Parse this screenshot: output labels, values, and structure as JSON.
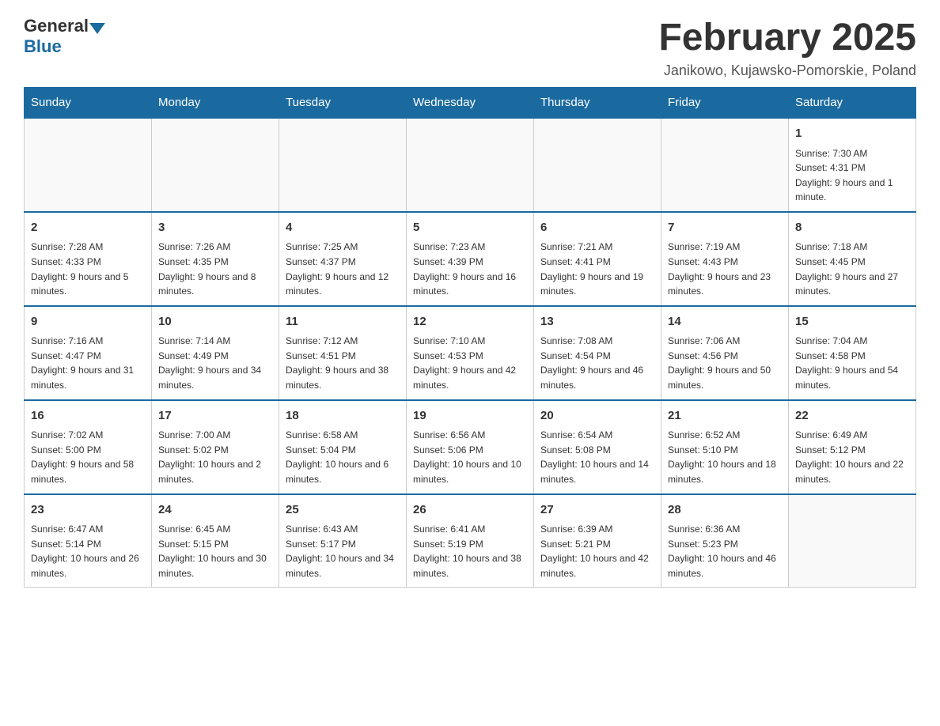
{
  "logo": {
    "text_general": "General",
    "text_blue": "Blue"
  },
  "header": {
    "month_title": "February 2025",
    "location": "Janikowo, Kujawsko-Pomorskie, Poland"
  },
  "days_of_week": [
    "Sunday",
    "Monday",
    "Tuesday",
    "Wednesday",
    "Thursday",
    "Friday",
    "Saturday"
  ],
  "weeks": [
    [
      {
        "day": "",
        "info": ""
      },
      {
        "day": "",
        "info": ""
      },
      {
        "day": "",
        "info": ""
      },
      {
        "day": "",
        "info": ""
      },
      {
        "day": "",
        "info": ""
      },
      {
        "day": "",
        "info": ""
      },
      {
        "day": "1",
        "info": "Sunrise: 7:30 AM\nSunset: 4:31 PM\nDaylight: 9 hours and 1 minute."
      }
    ],
    [
      {
        "day": "2",
        "info": "Sunrise: 7:28 AM\nSunset: 4:33 PM\nDaylight: 9 hours and 5 minutes."
      },
      {
        "day": "3",
        "info": "Sunrise: 7:26 AM\nSunset: 4:35 PM\nDaylight: 9 hours and 8 minutes."
      },
      {
        "day": "4",
        "info": "Sunrise: 7:25 AM\nSunset: 4:37 PM\nDaylight: 9 hours and 12 minutes."
      },
      {
        "day": "5",
        "info": "Sunrise: 7:23 AM\nSunset: 4:39 PM\nDaylight: 9 hours and 16 minutes."
      },
      {
        "day": "6",
        "info": "Sunrise: 7:21 AM\nSunset: 4:41 PM\nDaylight: 9 hours and 19 minutes."
      },
      {
        "day": "7",
        "info": "Sunrise: 7:19 AM\nSunset: 4:43 PM\nDaylight: 9 hours and 23 minutes."
      },
      {
        "day": "8",
        "info": "Sunrise: 7:18 AM\nSunset: 4:45 PM\nDaylight: 9 hours and 27 minutes."
      }
    ],
    [
      {
        "day": "9",
        "info": "Sunrise: 7:16 AM\nSunset: 4:47 PM\nDaylight: 9 hours and 31 minutes."
      },
      {
        "day": "10",
        "info": "Sunrise: 7:14 AM\nSunset: 4:49 PM\nDaylight: 9 hours and 34 minutes."
      },
      {
        "day": "11",
        "info": "Sunrise: 7:12 AM\nSunset: 4:51 PM\nDaylight: 9 hours and 38 minutes."
      },
      {
        "day": "12",
        "info": "Sunrise: 7:10 AM\nSunset: 4:53 PM\nDaylight: 9 hours and 42 minutes."
      },
      {
        "day": "13",
        "info": "Sunrise: 7:08 AM\nSunset: 4:54 PM\nDaylight: 9 hours and 46 minutes."
      },
      {
        "day": "14",
        "info": "Sunrise: 7:06 AM\nSunset: 4:56 PM\nDaylight: 9 hours and 50 minutes."
      },
      {
        "day": "15",
        "info": "Sunrise: 7:04 AM\nSunset: 4:58 PM\nDaylight: 9 hours and 54 minutes."
      }
    ],
    [
      {
        "day": "16",
        "info": "Sunrise: 7:02 AM\nSunset: 5:00 PM\nDaylight: 9 hours and 58 minutes."
      },
      {
        "day": "17",
        "info": "Sunrise: 7:00 AM\nSunset: 5:02 PM\nDaylight: 10 hours and 2 minutes."
      },
      {
        "day": "18",
        "info": "Sunrise: 6:58 AM\nSunset: 5:04 PM\nDaylight: 10 hours and 6 minutes."
      },
      {
        "day": "19",
        "info": "Sunrise: 6:56 AM\nSunset: 5:06 PM\nDaylight: 10 hours and 10 minutes."
      },
      {
        "day": "20",
        "info": "Sunrise: 6:54 AM\nSunset: 5:08 PM\nDaylight: 10 hours and 14 minutes."
      },
      {
        "day": "21",
        "info": "Sunrise: 6:52 AM\nSunset: 5:10 PM\nDaylight: 10 hours and 18 minutes."
      },
      {
        "day": "22",
        "info": "Sunrise: 6:49 AM\nSunset: 5:12 PM\nDaylight: 10 hours and 22 minutes."
      }
    ],
    [
      {
        "day": "23",
        "info": "Sunrise: 6:47 AM\nSunset: 5:14 PM\nDaylight: 10 hours and 26 minutes."
      },
      {
        "day": "24",
        "info": "Sunrise: 6:45 AM\nSunset: 5:15 PM\nDaylight: 10 hours and 30 minutes."
      },
      {
        "day": "25",
        "info": "Sunrise: 6:43 AM\nSunset: 5:17 PM\nDaylight: 10 hours and 34 minutes."
      },
      {
        "day": "26",
        "info": "Sunrise: 6:41 AM\nSunset: 5:19 PM\nDaylight: 10 hours and 38 minutes."
      },
      {
        "day": "27",
        "info": "Sunrise: 6:39 AM\nSunset: 5:21 PM\nDaylight: 10 hours and 42 minutes."
      },
      {
        "day": "28",
        "info": "Sunrise: 6:36 AM\nSunset: 5:23 PM\nDaylight: 10 hours and 46 minutes."
      },
      {
        "day": "",
        "info": ""
      }
    ]
  ]
}
